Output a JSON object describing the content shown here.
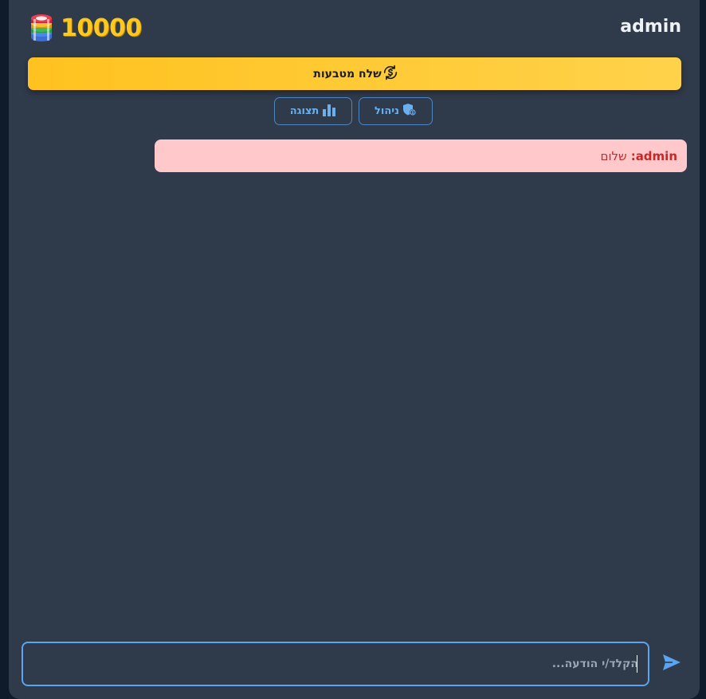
{
  "header": {
    "balance": "10000",
    "username": "admin",
    "chips_icon": "poker-chips-icon"
  },
  "actions": {
    "send_coins_label": "שלח מטבעות",
    "send_coins_icon": "coin-exchange-icon"
  },
  "nav": {
    "manage_label": "ניהול",
    "manage_icon": "shield-user-icon",
    "display_label": "תצוגה",
    "display_icon": "bar-chart-icon"
  },
  "messages": [
    {
      "author": "admin",
      "separator": ":",
      "text": "שלום"
    }
  ],
  "composer": {
    "placeholder": "הקלד/י הודעה...",
    "value": "",
    "send_icon": "send-arrow-icon"
  },
  "colors": {
    "background": "#0f1b2a",
    "panel": "#2f3a4b",
    "accent_gold": "#ffc81e",
    "accent_blue": "#5aa4f0",
    "message_bg": "#ffc9cc",
    "message_text": "#c62828"
  }
}
